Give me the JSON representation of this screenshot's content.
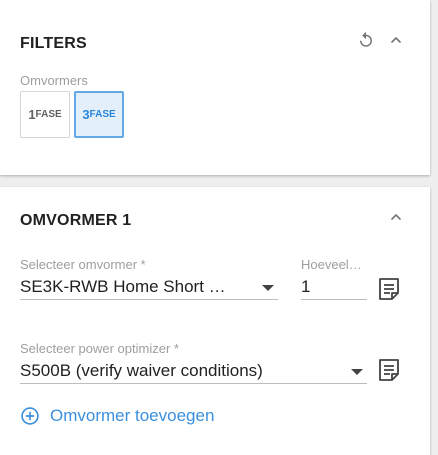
{
  "filters": {
    "title": "FILTERS",
    "section_label": "Omvormers",
    "phase_options": [
      {
        "num": "1",
        "word": "FASE",
        "selected": false
      },
      {
        "num": "3",
        "word": "FASE",
        "selected": true
      }
    ]
  },
  "inverter": {
    "title": "OMVORMER 1",
    "select_inverter": {
      "label": "Selecteer omvormer *",
      "value": "SE3K-RWB Home Short …"
    },
    "quantity": {
      "label": "Hoeveel…",
      "value": "1"
    },
    "select_optimizer": {
      "label": "Selecteer power optimizer *",
      "value": "S500B (verify waiver conditions)"
    },
    "add_label": "Omvormer toevoegen"
  },
  "colors": {
    "accent": "#3b8fdd",
    "active_bg": "#e3f0fb",
    "active_border": "#64a8e6"
  },
  "icons": [
    "reset-icon",
    "chevron-up-icon",
    "note-icon",
    "add-circle-icon",
    "dropdown-caret-icon"
  ]
}
